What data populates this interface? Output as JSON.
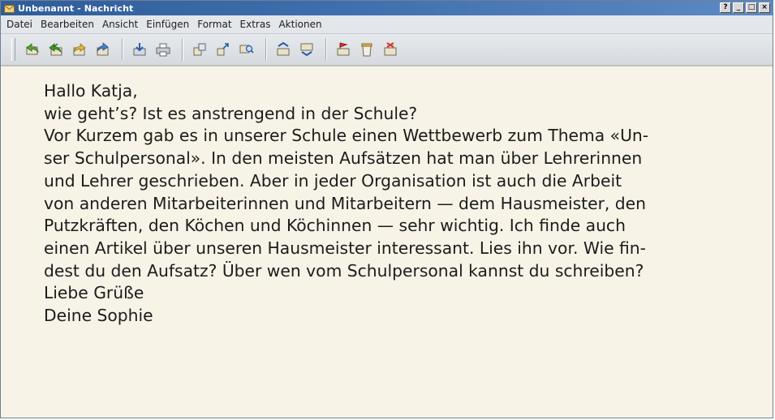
{
  "window": {
    "title": "Unbenannt - Nachricht",
    "controls": [
      "help",
      "minimize",
      "maximize",
      "close"
    ]
  },
  "menu": {
    "items": [
      "Datei",
      "Bearbeiten",
      "Ansicht",
      "Einfügen",
      "Format",
      "Extras",
      "Aktionen"
    ]
  },
  "toolbar": {
    "groups": [
      [
        "reply-icon",
        "reply-all-icon",
        "forward-icon",
        "forward-alt-icon"
      ],
      [
        "save-icon",
        "print-icon"
      ],
      [
        "move-icon",
        "copy-icon",
        "find-icon"
      ],
      [
        "previous-message-icon",
        "next-message-icon"
      ],
      [
        "flag-icon",
        "delete-icon",
        "close-message-icon"
      ]
    ]
  },
  "message": {
    "lines": [
      "Hallo Katja,",
      "wie geht’s? Ist es anstrengend in der Schule?",
      "Vor Kurzem gab es in unserer Schule einen Wettbewerb zum Thema «Un-",
      "ser Schulpersonal». In den meisten Aufsätzen hat man über Lehrerinnen",
      "und Lehrer geschrieben. Aber in jeder Organisation ist auch die Arbeit",
      "von anderen Mitarbeiterinnen und Mitarbeitern — dem Hausmeister, den",
      "Putzkräften, den Köchen und Köchinnen — sehr wichtig. Ich finde auch",
      "einen Artikel über unseren Hausmeister interessant. Lies ihn vor. Wie fin-",
      "dest du den Aufsatz? Über wen vom Schulpersonal kannst du schreiben?",
      "Liebe Grüße",
      "Deine Sophie"
    ]
  },
  "colors": {
    "titlebar": "#3f6fae",
    "message_background": "#f7f3e6",
    "text": "#1c1c1c"
  }
}
